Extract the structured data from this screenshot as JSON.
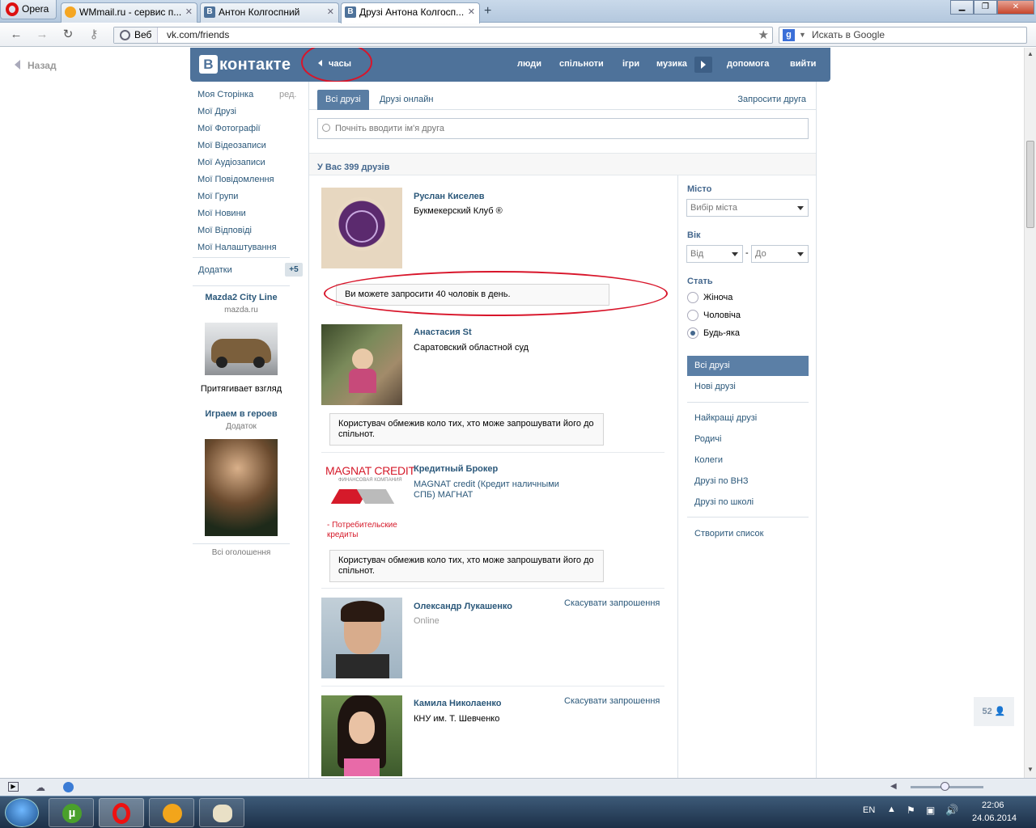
{
  "browser": {
    "opera_label": "Opera",
    "tabs": [
      {
        "label": "WMmail.ru - сервис п..."
      },
      {
        "label": "Антон Колгоспний"
      },
      {
        "label": "Друзі Антона Колгосп..."
      }
    ],
    "url_scheme_label": "Веб",
    "url": "vk.com/friends",
    "search_placeholder": "Искать в Google"
  },
  "page": {
    "back_label": "Назад",
    "header": {
      "logo_text": "контакте",
      "logo_letter": "В",
      "clock_label": "часы",
      "menu": [
        "люди",
        "спільноти",
        "ігри",
        "музика",
        "допомога",
        "вийти"
      ]
    },
    "left_menu": {
      "items": [
        "Моя Сторінка",
        "Мої Друзі",
        "Мої Фотографії",
        "Мої Відеозаписи",
        "Мої Аудіозаписи",
        "Мої Повідомлення",
        "Мої Групи",
        "Мої Новини",
        "Мої Відповіді",
        "Мої Налаштування"
      ],
      "edit_label": "ред.",
      "apps_label": "Додатки",
      "apps_badge": "+5"
    },
    "ads": [
      {
        "title": "Mazda2 City Line",
        "sub": "mazda.ru",
        "caption": "Притягивает взгляд"
      },
      {
        "title": "Играем в героев",
        "sub": "Додаток"
      }
    ],
    "ads_all": "Всі оголошення",
    "tabs": {
      "all": "Всі друзі",
      "online": "Друзі онлайн",
      "invite": "Запросити друга"
    },
    "search_placeholder": "Почніть вводити ім'я друга",
    "count_text": "У Вас 399 друзів",
    "friends": [
      {
        "name": "Руслан Киселев",
        "sub": "Букмекерский Клуб ®",
        "notice": "Ви можете запросити 40 чоловік в день."
      },
      {
        "name": "Анастасия St",
        "sub": "Саратовский областной суд",
        "notice": "Користувач обмежив коло тих, хто може запрошувати його до спільнот."
      },
      {
        "name": "Кредитный Брокер",
        "sub": "MAGNAT credit (Кредит наличными СПБ) МАГНАТ",
        "logo_text": "MAGNAT CREDIT",
        "logo_sub": "ФИНАНСОВАЯ КОМПАНИЯ",
        "logo_caption": "- Потребительские кредиты",
        "notice": "Користувач обмежив коло тих, хто може запрошувати його до спільнот."
      },
      {
        "name": "Олександр Лукашенко",
        "online": "Online",
        "cancel": "Скасувати запрошення"
      },
      {
        "name": "Камила Николаенко",
        "sub": "КНУ им. Т. Шевченко",
        "cancel": "Скасувати запрошення"
      }
    ],
    "filters": {
      "city_label": "Місто",
      "city_value": "Вибір міста",
      "age_label": "Вік",
      "age_from": "Від",
      "age_dash": "-",
      "age_to": "До",
      "sex_label": "Стать",
      "sex_options": [
        "Жіноча",
        "Чоловіча",
        "Будь-яка"
      ]
    },
    "right_menu": {
      "active": "Всі друзі",
      "items": [
        "Нові друзі",
        "Найкращі друзі",
        "Родичі",
        "Колеги",
        "Друзі по ВНЗ",
        "Друзі по школі",
        "Створити список"
      ]
    },
    "counter": "52"
  },
  "taskbar": {
    "lang": "EN",
    "time": "22:06",
    "date": "24.06.2014"
  },
  "colors": {
    "vk_blue": "#4e729a",
    "link": "#2b587a",
    "annotation_red": "#d8152a"
  }
}
